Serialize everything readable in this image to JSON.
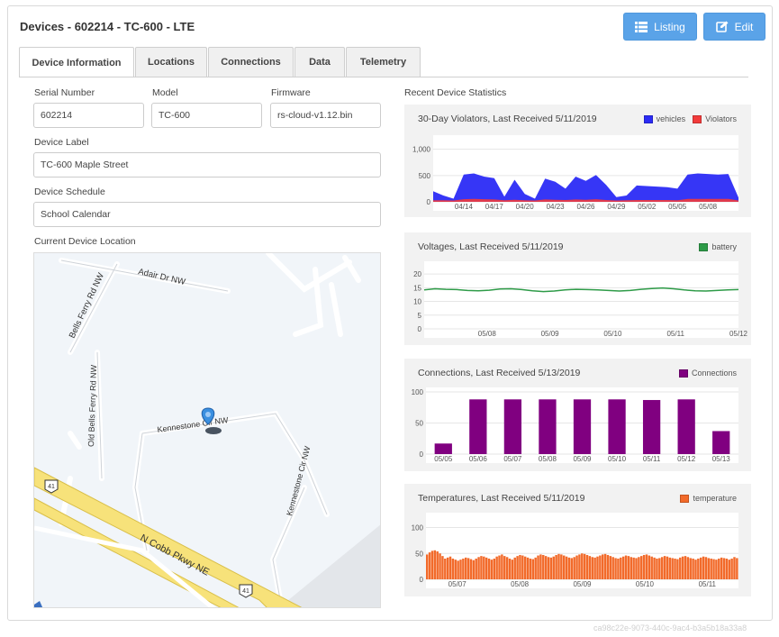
{
  "page": {
    "title": "Devices - 602214 - TC-600 - LTE",
    "watermark": "ca98c22e-9073-440c-9ac4-b3a5b18a33a8"
  },
  "toolbar": {
    "listing_label": "Listing",
    "edit_label": "Edit"
  },
  "tabs": [
    {
      "label": "Device Information",
      "active": true
    },
    {
      "label": "Locations"
    },
    {
      "label": "Connections"
    },
    {
      "label": "Data"
    },
    {
      "label": "Telemetry"
    }
  ],
  "form": {
    "serial_label": "Serial Number",
    "serial_value": "602214",
    "model_label": "Model",
    "model_value": "TC-600",
    "firmware_label": "Firmware",
    "firmware_value": "rs-cloud-v1.12.bin",
    "device_label_label": "Device Label",
    "device_label_value": "TC-600 Maple Street",
    "schedule_label": "Device Schedule",
    "schedule_value": "School Calendar",
    "location_label": "Current Device Location"
  },
  "map": {
    "streets": [
      "Adair Dr NW",
      "Bells Ferry Rd NW",
      "Old Bells Ferry Rd NW",
      "Kennestone Cir NW",
      "Kennestone Cir NW",
      "N Cobb Pkwy NE"
    ],
    "route_shields": [
      "41",
      "41"
    ]
  },
  "stats": {
    "title": "Recent Device Statistics"
  },
  "colors": {
    "vehicles": "#2b2bf5",
    "violators": "#f23b3b",
    "battery": "#2e9b48",
    "connections": "#800080",
    "temperature": "#f26a2a",
    "button": "#5aa3e8"
  },
  "chart_data": [
    {
      "type": "area",
      "title": "30-Day Violators, Last Received 5/11/2019",
      "x": [
        "04/11",
        "04/12",
        "04/13",
        "04/14",
        "04/15",
        "04/16",
        "04/17",
        "04/18",
        "04/19",
        "04/20",
        "04/21",
        "04/22",
        "04/23",
        "04/24",
        "04/25",
        "04/26",
        "04/27",
        "04/28",
        "04/29",
        "04/30",
        "05/01",
        "05/02",
        "05/03",
        "05/04",
        "05/05",
        "05/06",
        "05/07",
        "05/08",
        "05/09",
        "05/10",
        "05/11"
      ],
      "x_ticks": [
        "04/14",
        "04/17",
        "04/20",
        "04/23",
        "04/26",
        "04/29",
        "05/02",
        "05/05",
        "05/08"
      ],
      "y_ticks": [
        "0",
        "500",
        "1,000"
      ],
      "ylim": [
        0,
        1200
      ],
      "series": [
        {
          "name": "vehicles",
          "values": [
            200,
            120,
            60,
            520,
            540,
            480,
            450,
            100,
            420,
            150,
            60,
            440,
            380,
            250,
            480,
            400,
            510,
            320,
            90,
            120,
            310,
            300,
            290,
            280,
            250,
            520,
            540,
            530,
            520,
            530,
            80
          ]
        },
        {
          "name": "Violators",
          "values": [
            30,
            30,
            25,
            50,
            55,
            50,
            45,
            30,
            40,
            30,
            25,
            45,
            40,
            35,
            45,
            40,
            50,
            35,
            25,
            30,
            35,
            35,
            35,
            35,
            30,
            55,
            55,
            55,
            55,
            55,
            25
          ]
        }
      ]
    },
    {
      "type": "line",
      "title": "Voltages, Last Received 5/11/2019",
      "x": [
        "05/07",
        "05/08",
        "05/09",
        "05/10",
        "05/11",
        "05/12"
      ],
      "x_ticks": [
        "05/08",
        "05/09",
        "05/10",
        "05/11",
        "05/12"
      ],
      "y_ticks": [
        "0",
        "5",
        "10",
        "15",
        "20"
      ],
      "ylim": [
        0,
        22
      ],
      "series": [
        {
          "name": "battery",
          "values": [
            14.2,
            14.6,
            14.4,
            14.3,
            14.0,
            13.9,
            14.1,
            14.5,
            14.6,
            14.3,
            13.9,
            13.6,
            13.8,
            14.2,
            14.4,
            14.3,
            14.2,
            14.0,
            13.8,
            14.0,
            14.4,
            14.7,
            14.9,
            14.6,
            14.2,
            13.9,
            13.8,
            14.0,
            14.2,
            14.3
          ]
        }
      ]
    },
    {
      "type": "bar",
      "title": "Connections, Last Received 5/13/2019",
      "categories": [
        "05/05",
        "05/06",
        "05/07",
        "05/08",
        "05/09",
        "05/10",
        "05/11",
        "05/12",
        "05/13"
      ],
      "y_ticks": [
        "0",
        "50",
        "100"
      ],
      "ylim": [
        0,
        100
      ],
      "series": [
        {
          "name": "Connections",
          "values": [
            17,
            88,
            88,
            88,
            88,
            88,
            87,
            88,
            37
          ]
        }
      ]
    },
    {
      "type": "bar",
      "title": "Temperatures, Last Received 5/11/2019",
      "x_ticks": [
        "05/07",
        "05/08",
        "05/09",
        "05/10",
        "05/11"
      ],
      "y_ticks": [
        "0",
        "50",
        "100"
      ],
      "ylim": [
        0,
        120
      ],
      "series": [
        {
          "name": "temperature",
          "values": [
            48,
            52,
            55,
            56,
            54,
            50,
            45,
            40,
            42,
            44,
            40,
            38,
            36,
            38,
            40,
            42,
            41,
            39,
            37,
            40,
            43,
            45,
            44,
            42,
            40,
            38,
            40,
            44,
            46,
            48,
            45,
            43,
            40,
            38,
            42,
            45,
            47,
            46,
            44,
            42,
            40,
            39,
            42,
            46,
            48,
            47,
            45,
            43,
            42,
            44,
            47,
            49,
            48,
            46,
            44,
            42,
            41,
            43,
            46,
            48,
            50,
            49,
            47,
            45,
            43,
            42,
            44,
            46,
            48,
            49,
            47,
            45,
            43,
            41,
            40,
            42,
            44,
            46,
            45,
            43,
            42,
            41,
            43,
            45,
            47,
            48,
            46,
            44,
            42,
            40,
            41,
            43,
            45,
            44,
            42,
            41,
            40,
            39,
            42,
            44,
            45,
            43,
            41,
            40,
            38,
            40,
            42,
            44,
            43,
            41,
            40,
            39,
            38,
            40,
            42,
            41,
            40,
            38,
            40,
            43,
            41
          ]
        }
      ]
    }
  ]
}
